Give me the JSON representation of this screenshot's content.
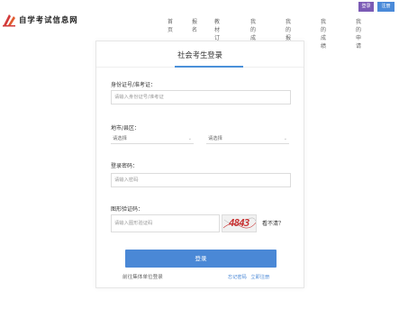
{
  "site": {
    "title": "自学考试信息网"
  },
  "nav": {
    "items": [
      "首页",
      "报名",
      "教材订购",
      "我的成绩",
      "我的报名",
      "我的成绩",
      "我的申请"
    ]
  },
  "top_buttons": {
    "login": "登录",
    "register": "注册"
  },
  "login_form": {
    "title": "社会考生登录",
    "id_label": "身份证号/准考证：",
    "id_placeholder": "请输入身份证号/准考证",
    "region_label": "地市/县区：",
    "city_select": "请选择",
    "district_select": "请选择",
    "password_label": "登录密码：",
    "password_placeholder": "请输入密码",
    "captcha_label": "图形验证码：",
    "captcha_placeholder": "请输入图形验证码",
    "captcha_text": "4843",
    "captcha_refresh": "看不清？",
    "submit_label": "登录",
    "unit_login_link": "前往集体单位登录",
    "forgot_password_link": "忘记密码",
    "register_link": "立即注册"
  },
  "colors": {
    "accent": "#4a88d6",
    "login_btn": "#7b5bb5",
    "captcha_red": "#c83232",
    "logo_red": "#d23a3a"
  }
}
